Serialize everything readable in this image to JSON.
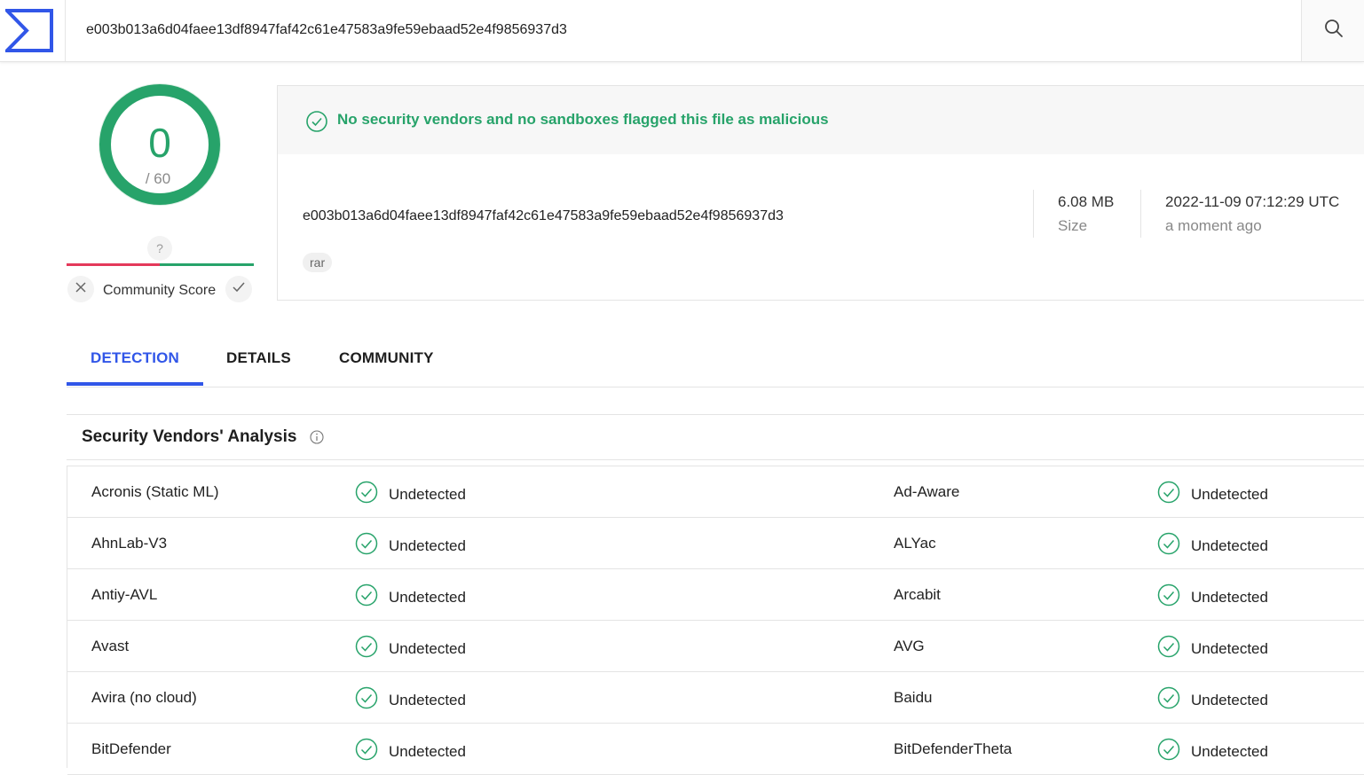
{
  "header": {
    "search_value": "e003b013a6d04faee13df8947faf42c61e47583a9fe59ebaad52e4f9856937d3",
    "logo_icon": "virustotal-logo-icon",
    "search_icon": "search-icon",
    "accent_color": "#3156e8"
  },
  "score": {
    "detections": "0",
    "total": "/ 60",
    "unknown_badge": "?",
    "community_label": "Community Score",
    "color": "#27a36a"
  },
  "summary": {
    "banner": "No security vendors and no sandboxes flagged this file as malicious",
    "hash": "e003b013a6d04faee13df8947faf42c61e47583a9fe59ebaad52e4f9856937d3",
    "tag": "rar",
    "size_value": "6.08 MB",
    "size_label": "Size",
    "date_value": "2022-11-09 07:12:29 UTC",
    "date_relative": "a moment ago"
  },
  "tabs": [
    {
      "label": "DETECTION",
      "active": true
    },
    {
      "label": "DETAILS",
      "active": false
    },
    {
      "label": "COMMUNITY",
      "active": false
    }
  ],
  "vendors": {
    "title": "Security Vendors' Analysis",
    "rows": [
      {
        "left": {
          "name": "Acronis (Static ML)",
          "status": "Undetected"
        },
        "right": {
          "name": "Ad-Aware",
          "status": "Undetected"
        }
      },
      {
        "left": {
          "name": "AhnLab-V3",
          "status": "Undetected"
        },
        "right": {
          "name": "ALYac",
          "status": "Undetected"
        }
      },
      {
        "left": {
          "name": "Antiy-AVL",
          "status": "Undetected"
        },
        "right": {
          "name": "Arcabit",
          "status": "Undetected"
        }
      },
      {
        "left": {
          "name": "Avast",
          "status": "Undetected"
        },
        "right": {
          "name": "AVG",
          "status": "Undetected"
        }
      },
      {
        "left": {
          "name": "Avira (no cloud)",
          "status": "Undetected"
        },
        "right": {
          "name": "Baidu",
          "status": "Undetected"
        }
      },
      {
        "left": {
          "name": "BitDefender",
          "status": "Undetected"
        },
        "right": {
          "name": "BitDefenderTheta",
          "status": "Undetected"
        }
      }
    ]
  }
}
